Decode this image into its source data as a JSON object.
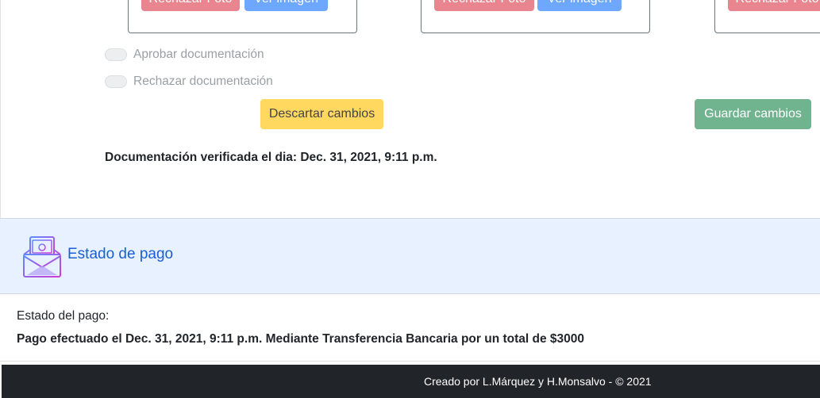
{
  "photo_cards": [
    {
      "reject_label": "Rechazar Foto",
      "view_label": "Ver imagen"
    },
    {
      "reject_label": "Rechazar Foto",
      "view_label": "Ver imagen"
    },
    {
      "reject_label": "Rechazar Foto"
    }
  ],
  "review": {
    "approve_label": "Aprobar documentación",
    "reject_label": "Rechazar documentación",
    "discard_label": "Descartar cambios",
    "save_label": "Guardar cambios",
    "verified_text": "Documentación verificada el dia: Dec. 31, 2021, 9:11 p.m."
  },
  "payment": {
    "section_title": "Estado de pago",
    "status_label": "Estado del pago:",
    "status_text": "Pago efectuado el Dec. 31, 2021, 9:11 p.m. Mediante Transferencia Bancaria por un total de $3000",
    "icon": "money-envelope-icon"
  },
  "footer": {
    "text": "Creado por L.Márquez y H.Monsalvo - © 2021"
  },
  "colors": {
    "reject": "#e8858e",
    "view": "#6ea8fe",
    "warning": "#ffd85f",
    "success": "#6fb38f",
    "header_bg": "#e7f1ff",
    "title": "#1a5fd6",
    "footer_bg": "#212529"
  }
}
